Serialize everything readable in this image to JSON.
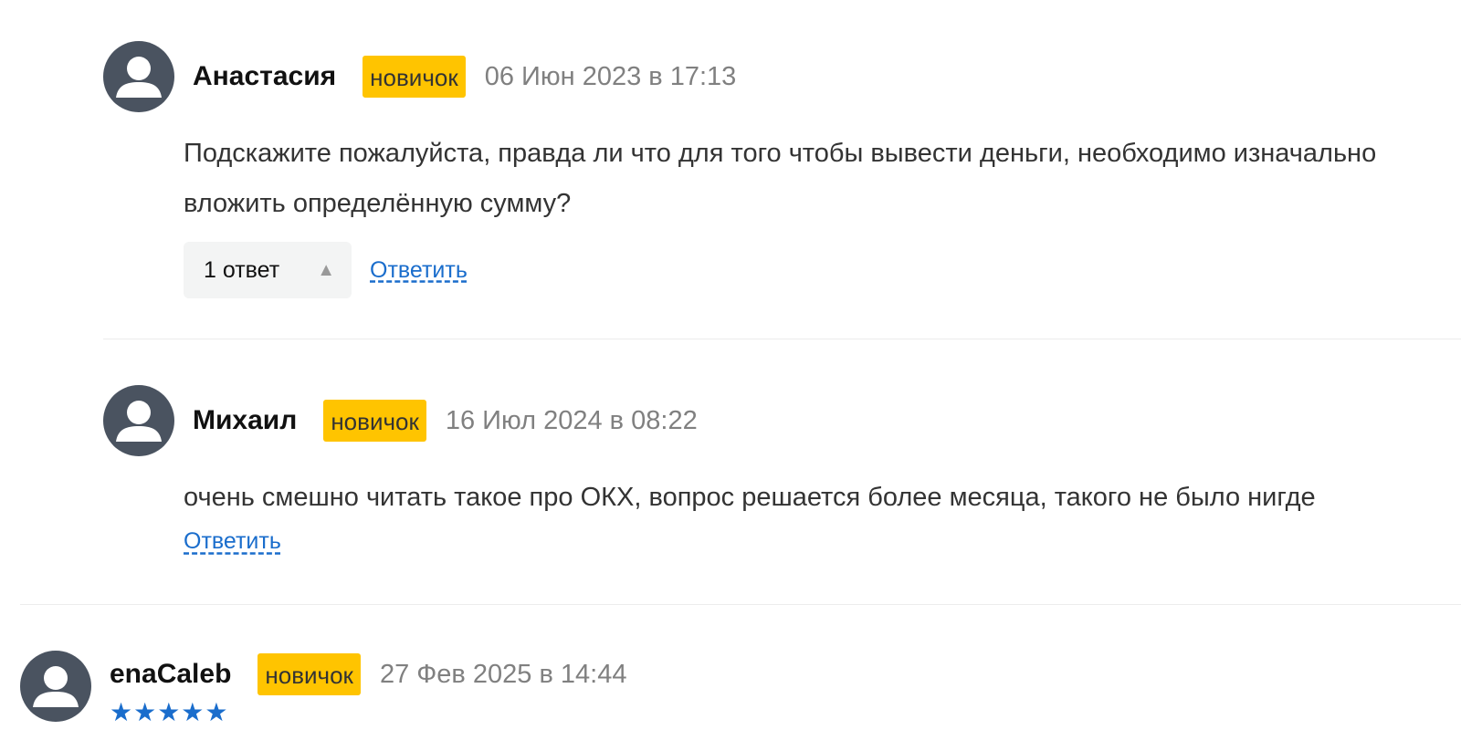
{
  "comments": [
    {
      "author": "Анастасия",
      "badge": "новичок",
      "date": "06 Июн 2023 в 17:13",
      "text": "Подскажите пожалуйста, правда ли что для того чтобы вывести деньги, необходимо изначально вложить определённую сумму?",
      "replies_toggle": "1 ответ",
      "reply_label": "Ответить"
    },
    {
      "author": "Михаил",
      "badge": "новичок",
      "date": "16 Июл 2024 в 08:22",
      "text": "очень смешно читать такое про ОКХ, вопрос решается более месяца, такого не было нигде",
      "reply_label": "Ответить"
    },
    {
      "author": "enaCaleb",
      "badge": "новичок",
      "date": "27 Фев 2025 в 14:44",
      "stars": "★★★★★",
      "rating": 5
    }
  ],
  "icons": {
    "avatar": "user-avatar-icon",
    "toggle_arrow": "▲"
  },
  "colors": {
    "badge": "#ffc400",
    "link": "#1a6dcc",
    "avatar_bg": "#4a5360",
    "date": "#808080"
  }
}
